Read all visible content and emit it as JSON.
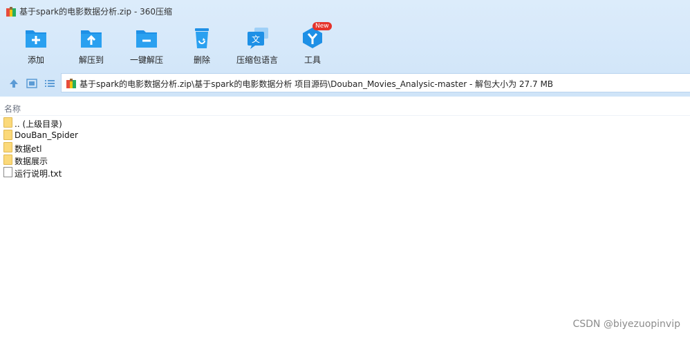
{
  "window": {
    "title": "基于spark的电影数据分析.zip - 360压缩"
  },
  "toolbar": {
    "buttons": [
      {
        "label": "添加",
        "icon": "add-folder-icon"
      },
      {
        "label": "解压到",
        "icon": "extract-to-icon"
      },
      {
        "label": "一键解压",
        "icon": "one-click-extract-icon"
      },
      {
        "label": "删除",
        "icon": "recycle-bin-icon"
      },
      {
        "label": "压缩包语言",
        "icon": "language-icon"
      },
      {
        "label": "工具",
        "icon": "tools-icon",
        "badge": "New"
      }
    ]
  },
  "address": {
    "path": "基于spark的电影数据分析.zip\\基于spark的电影数据分析 项目源码\\Douban_Movies_Analysic-master - 解包大小为 27.7 MB",
    "nav_icons": [
      "up-arrow-icon",
      "view-thumbnail-icon",
      "view-list-icon"
    ]
  },
  "columns": {
    "name": "名称"
  },
  "files": [
    {
      "name": ".. (上级目录)",
      "type": "folder"
    },
    {
      "name": "DouBan_Spider",
      "type": "folder"
    },
    {
      "name": "数据etl",
      "type": "folder"
    },
    {
      "name": "数据展示",
      "type": "folder"
    },
    {
      "name": "运行说明.txt",
      "type": "file"
    }
  ],
  "watermark": "CSDN @biyezuopinvip",
  "colors": {
    "accent": "#1e90e6",
    "toolbar_bg": "#d6e8fa",
    "folder": "#fbd97a"
  }
}
